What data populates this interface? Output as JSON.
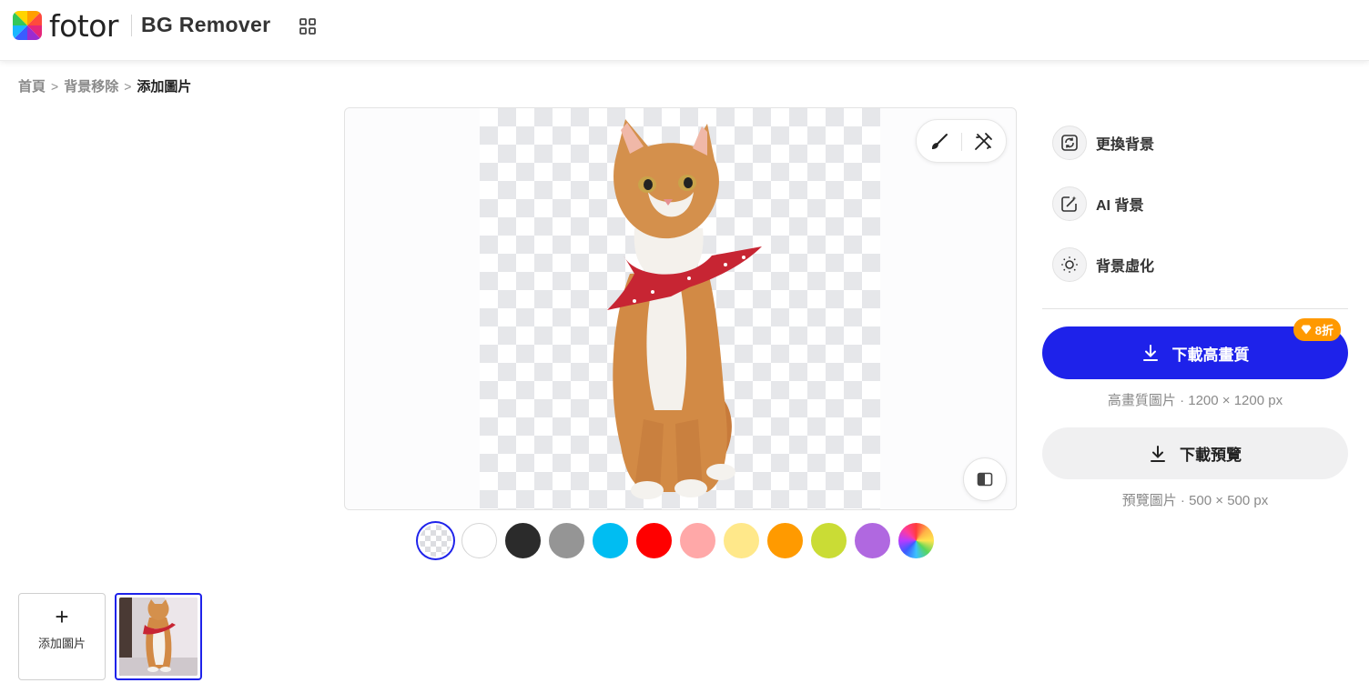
{
  "header": {
    "logo_text": "fotor",
    "product_name": "BG Remover"
  },
  "breadcrumb": {
    "items": [
      "首頁",
      "背景移除",
      "添加圖片"
    ],
    "separator": ">"
  },
  "swatches": [
    {
      "name": "transparent",
      "color": "transparent",
      "selected": true
    },
    {
      "name": "white",
      "color": "#ffffff"
    },
    {
      "name": "black",
      "color": "#2b2b2b"
    },
    {
      "name": "gray",
      "color": "#959595"
    },
    {
      "name": "cyan",
      "color": "#00bdf2"
    },
    {
      "name": "red",
      "color": "#ff0000"
    },
    {
      "name": "pink",
      "color": "#ffa8a8"
    },
    {
      "name": "light-yellow",
      "color": "#ffe88a"
    },
    {
      "name": "orange",
      "color": "#ff9a00"
    },
    {
      "name": "lime",
      "color": "#cadc35"
    },
    {
      "name": "purple",
      "color": "#b068e0"
    },
    {
      "name": "rainbow",
      "color": "multicolor"
    }
  ],
  "side_menu": [
    {
      "label": "更換背景",
      "icon": "change-background-icon"
    },
    {
      "label": "AI 背景",
      "icon": "ai-background-icon"
    },
    {
      "label": "背景虛化",
      "icon": "blur-background-icon"
    }
  ],
  "download_hq": {
    "label": "下載高畫質",
    "badge": "8折",
    "info": "高畫質圖片 · 1200 × 1200 px"
  },
  "download_preview": {
    "label": "下載預覽",
    "info": "預覽圖片 · 500 × 500 px"
  },
  "bottom": {
    "add_label": "添加圖片",
    "add_icon": "+"
  },
  "colors": {
    "accent": "#1e22ea",
    "badge": "#ff9900"
  }
}
